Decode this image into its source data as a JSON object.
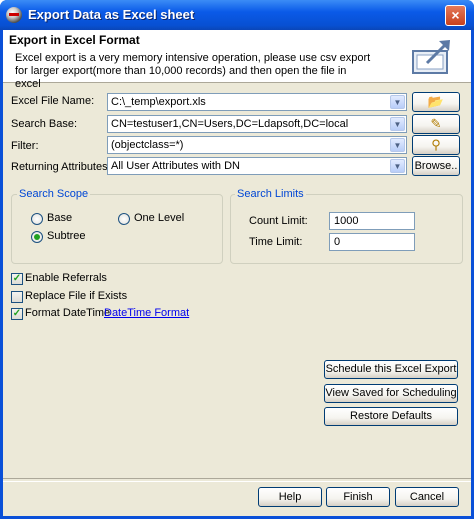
{
  "window": {
    "title": "Export Data as Excel sheet",
    "close_glyph": "×"
  },
  "header": {
    "title": "Export in Excel Format",
    "description": "Excel export is a very memory intensive operation, please use csv export for larger export(more than 10,000 records) and then open the file in excel"
  },
  "form": {
    "file_label": "Excel File Name:",
    "file_value": "C:\\_temp\\export.xls",
    "search_base_label": "Search Base:",
    "search_base_value": "CN=testuser1,CN=Users,DC=Ldapsoft,DC=local",
    "filter_label": "Filter:",
    "filter_value": "(objectclass=*)",
    "attributes_label": "Returning Attributes:",
    "attributes_value": "All User Attributes with DN",
    "browse_label": "Browse..",
    "dropdown_glyph": "▼",
    "folder_glyph": "📂",
    "wand_glyph": "✎",
    "filter_glyph": "⚲"
  },
  "scope": {
    "title": "Search Scope",
    "base_label": "Base",
    "one_level_label": "One Level",
    "subtree_label": "Subtree",
    "selected": "Subtree"
  },
  "limits": {
    "title": "Search Limits",
    "count_label": "Count Limit:",
    "count_value": "1000",
    "time_label": "Time Limit:",
    "time_value": "0"
  },
  "options": {
    "check_glyph": "✓",
    "enable_referrals_label": "Enable Referrals",
    "enable_referrals_checked": true,
    "replace_file_label": "Replace File if Exists",
    "replace_file_checked": false,
    "format_datetime_label": "Format DateTime",
    "format_datetime_checked": true,
    "datetime_format_link": "DateTime Format"
  },
  "actions": {
    "schedule_label": "Schedule this Excel Export",
    "view_saved_label": "View Saved for Scheduling",
    "restore_label": "Restore Defaults"
  },
  "footer": {
    "help_label": "Help",
    "finish_label": "Finish",
    "cancel_label": "Cancel"
  },
  "colors": {
    "title_bar": "#0a5ae8",
    "dialog_bg": "#ece9d8",
    "group_title": "#0046d5",
    "link": "#0000ee",
    "radio_check": "#21a121"
  }
}
